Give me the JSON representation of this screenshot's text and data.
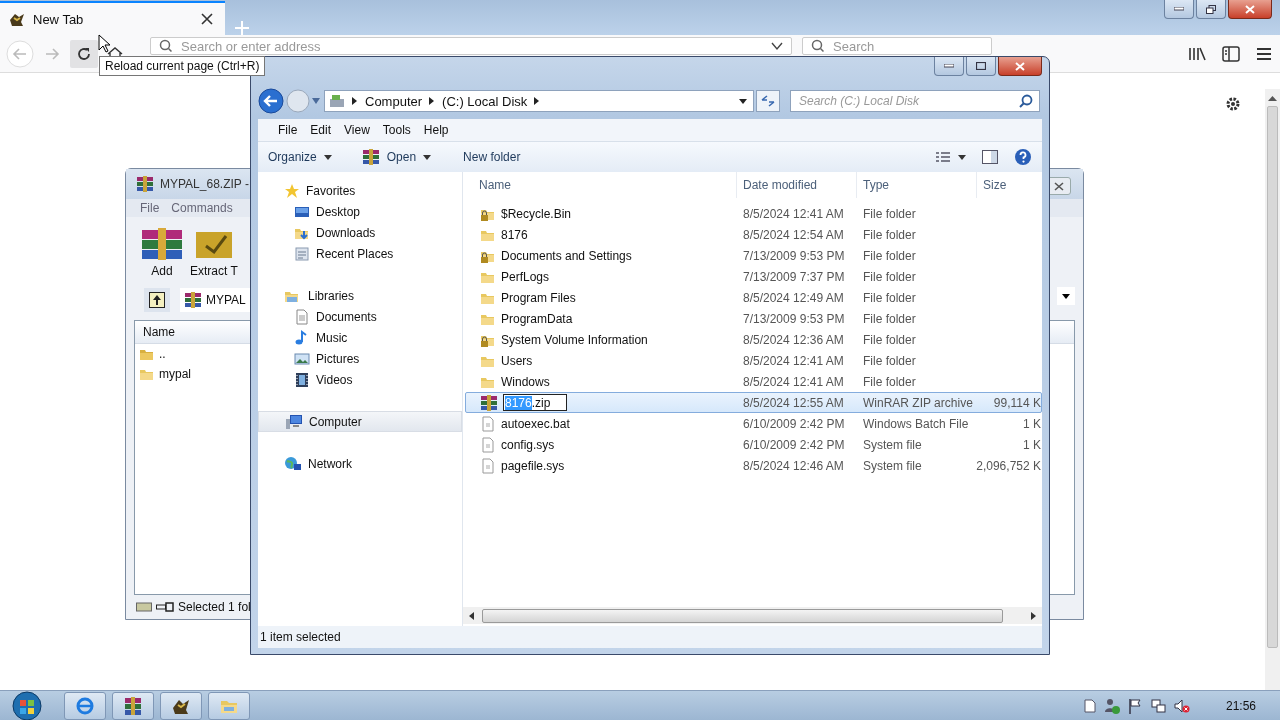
{
  "browser": {
    "tab": {
      "title": "New Tab",
      "selected": true
    },
    "address_field": {
      "placeholder": "Search or enter address"
    },
    "search_field": {
      "placeholder": "Search"
    },
    "tooltip": "Reload current page (Ctrl+R)"
  },
  "winrar": {
    "title": "MYPAL_68.ZIP -",
    "menu": [
      "File",
      "Commands"
    ],
    "toolbar": [
      {
        "label": "Add",
        "kind": "add"
      },
      {
        "label": "Extract T",
        "kind": "extract"
      }
    ],
    "path": "MYPAL",
    "columns": [
      "Name"
    ],
    "rows": [
      {
        "name": "..",
        "kind": "parent"
      },
      {
        "name": "mypal",
        "kind": "folder"
      }
    ],
    "status": "Selected 1 fol"
  },
  "explorer": {
    "breadcrumb": [
      "Computer",
      "(C:) Local Disk"
    ],
    "search_field": {
      "placeholder": "Search (C:) Local Disk"
    },
    "menu": [
      "File",
      "Edit",
      "View",
      "Tools",
      "Help"
    ],
    "commands": [
      {
        "label": "Organize",
        "kind": "menu"
      },
      {
        "label": "Open",
        "kind": "app-menu"
      },
      {
        "label": "New folder",
        "kind": "plain"
      }
    ],
    "nav": [
      {
        "label": "Favorites",
        "kind": "star",
        "selected": false,
        "children": [
          {
            "label": "Desktop",
            "kind": "desktop",
            "selected": false
          },
          {
            "label": "Downloads",
            "kind": "downloads",
            "selected": false
          },
          {
            "label": "Recent Places",
            "kind": "recent",
            "selected": false
          }
        ]
      },
      {
        "label": "Libraries",
        "kind": "library",
        "selected": false,
        "children": [
          {
            "label": "Documents",
            "kind": "document",
            "selected": false
          },
          {
            "label": "Music",
            "kind": "music",
            "selected": false
          },
          {
            "label": "Pictures",
            "kind": "pictures",
            "selected": false
          },
          {
            "label": "Videos",
            "kind": "videos",
            "selected": false
          }
        ]
      },
      {
        "label": "Computer",
        "kind": "computer",
        "selected": true
      },
      {
        "label": "Network",
        "kind": "network",
        "selected": false
      }
    ],
    "columns": [
      "Name",
      "Date modified",
      "Type",
      "Size"
    ],
    "rows": [
      {
        "name": "$Recycle.Bin",
        "date": "8/5/2024 12:41 AM",
        "type": "File folder",
        "kind": "locked-folder",
        "selected": false
      },
      {
        "name": "8176",
        "date": "8/5/2024 12:54 AM",
        "type": "File folder",
        "kind": "folder",
        "selected": false
      },
      {
        "name": "Documents and Settings",
        "date": "7/13/2009 9:53 PM",
        "type": "File folder",
        "kind": "locked-folder",
        "selected": false
      },
      {
        "name": "PerfLogs",
        "date": "7/13/2009 7:37 PM",
        "type": "File folder",
        "kind": "folder",
        "selected": false
      },
      {
        "name": "Program Files",
        "date": "8/5/2024 12:49 AM",
        "type": "File folder",
        "kind": "folder",
        "selected": false
      },
      {
        "name": "ProgramData",
        "date": "7/13/2009 9:53 PM",
        "type": "File folder",
        "kind": "folder",
        "selected": false
      },
      {
        "name": "System Volume Information",
        "date": "8/5/2024 12:36 AM",
        "type": "File folder",
        "kind": "locked-folder",
        "selected": false
      },
      {
        "name": "Users",
        "date": "8/5/2024 12:41 AM",
        "type": "File folder",
        "kind": "folder",
        "selected": false
      },
      {
        "name": "Windows",
        "date": "8/5/2024 12:41 AM",
        "type": "File folder",
        "kind": "folder",
        "selected": false
      },
      {
        "rename": {
          "selection": "8176",
          "rest": ".zip"
        },
        "date": "8/5/2024 12:55 AM",
        "type": "WinRAR ZIP archive",
        "size": "99,114 K",
        "kind": "archive",
        "selected": true
      },
      {
        "name": "autoexec.bat",
        "date": "6/10/2009 2:42 PM",
        "type": "Windows Batch File",
        "size": "1 K",
        "kind": "file",
        "selected": false
      },
      {
        "name": "config.sys",
        "date": "6/10/2009 2:42 PM",
        "type": "System file",
        "size": "1 K",
        "kind": "file",
        "selected": false
      },
      {
        "name": "pagefile.sys",
        "date": "8/5/2024 12:46 AM",
        "type": "System file",
        "size": "2,096,752 K",
        "kind": "file",
        "selected": false
      }
    ],
    "status": "1 item selected"
  },
  "taskbar": {
    "apps": [
      {
        "kind": "browser-e"
      },
      {
        "kind": "archive"
      },
      {
        "kind": "mypal"
      },
      {
        "kind": "folder"
      }
    ],
    "clock": "21:56"
  }
}
